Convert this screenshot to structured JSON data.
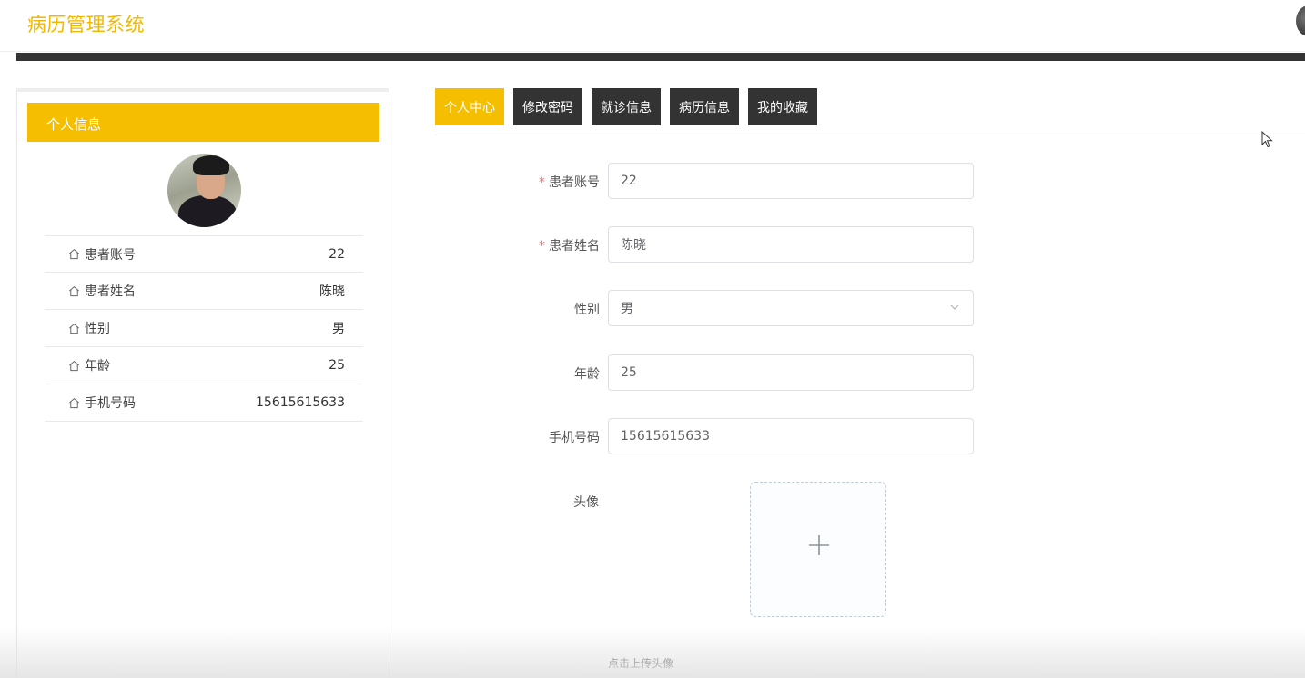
{
  "app": {
    "title": "病历管理系统"
  },
  "profile_panel": {
    "header": "个人信息",
    "rows": [
      {
        "label": "患者账号",
        "value": "22"
      },
      {
        "label": "患者姓名",
        "value": "陈晓"
      },
      {
        "label": "性别",
        "value": "男"
      },
      {
        "label": "年龄",
        "value": "25"
      },
      {
        "label": "手机号码",
        "value": "15615615633"
      }
    ]
  },
  "tabs": [
    {
      "label": "个人中心",
      "active": true
    },
    {
      "label": "修改密码",
      "active": false
    },
    {
      "label": "就诊信息",
      "active": false
    },
    {
      "label": "病历信息",
      "active": false
    },
    {
      "label": "我的收藏",
      "active": false
    }
  ],
  "form": {
    "account": {
      "label": "患者账号",
      "required": true,
      "value": "22"
    },
    "name": {
      "label": "患者姓名",
      "required": true,
      "value": "陈晓"
    },
    "gender": {
      "label": "性别",
      "value": "男"
    },
    "age": {
      "label": "年龄",
      "value": "25"
    },
    "phone": {
      "label": "手机号码",
      "value": "15615615633"
    },
    "avatar": {
      "label": "头像",
      "tip": "点击上传头像"
    }
  },
  "colors": {
    "accent": "#f5bf00",
    "title": "#f2b705",
    "dark": "#333333"
  }
}
